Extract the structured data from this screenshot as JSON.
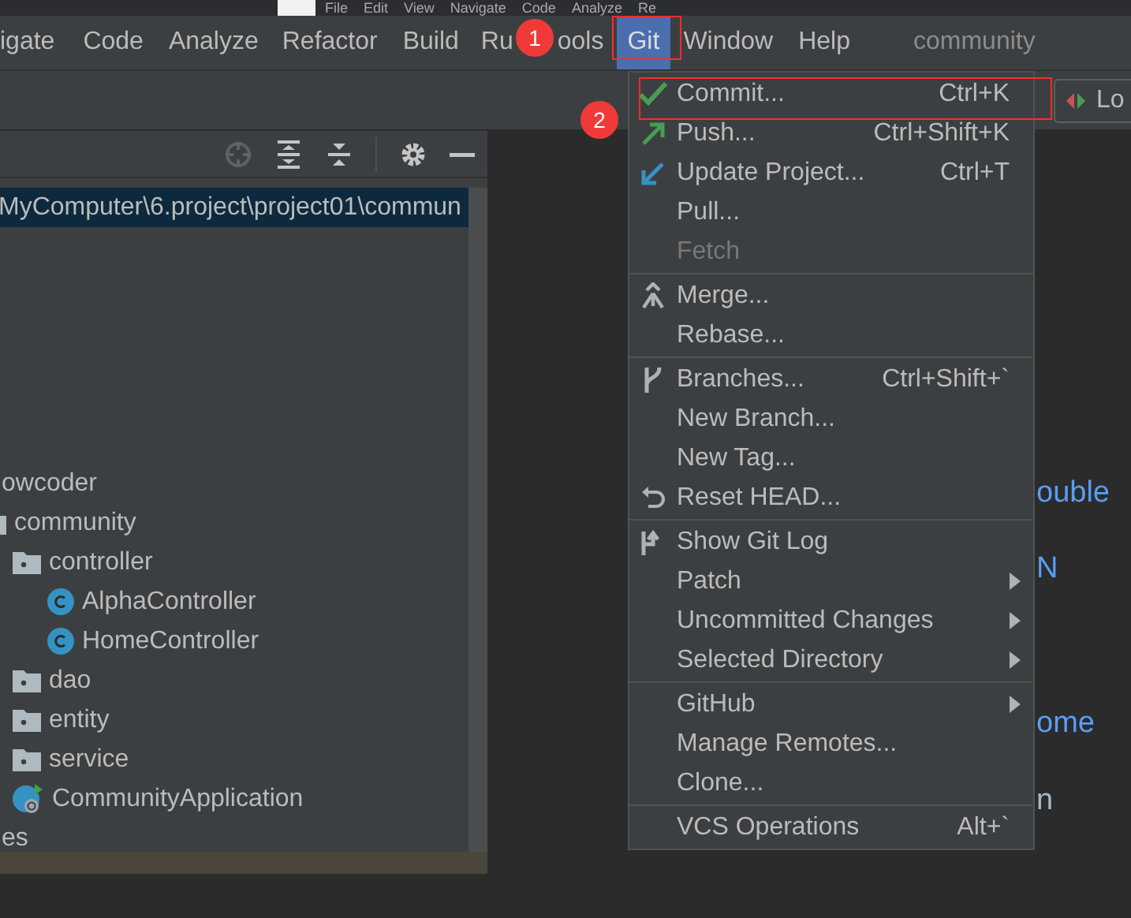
{
  "inner_menu": [
    "File",
    "Edit",
    "View",
    "Navigate",
    "Code",
    "Analyze",
    "Re"
  ],
  "menubar": {
    "items": [
      {
        "label": "igate",
        "selected": false
      },
      {
        "label": "Code",
        "selected": false
      },
      {
        "label": "Analyze",
        "selected": false
      },
      {
        "label": "Refactor",
        "selected": false
      },
      {
        "label": "Build",
        "selected": false
      },
      {
        "label": "Ru",
        "selected": false
      },
      {
        "label": "ools",
        "selected": false
      },
      {
        "label": "Git",
        "selected": true
      },
      {
        "label": "Window",
        "selected": false
      },
      {
        "label": "Help",
        "selected": false
      }
    ],
    "project": "community"
  },
  "toolbar": {
    "run_config": "Lo"
  },
  "project_panel": {
    "path": "MyComputer\\6.project\\project01\\commun",
    "tree": [
      {
        "label": "owcoder",
        "kind": "text"
      },
      {
        "label": "community",
        "kind": "folder",
        "children": [
          {
            "label": "controller",
            "kind": "folder",
            "children": [
              {
                "label": "AlphaController",
                "kind": "class"
              },
              {
                "label": "HomeController",
                "kind": "class"
              }
            ]
          },
          {
            "label": "dao",
            "kind": "folder"
          },
          {
            "label": "entity",
            "kind": "folder"
          },
          {
            "label": "service",
            "kind": "folder"
          },
          {
            "label": "CommunityApplication",
            "kind": "app"
          }
        ]
      },
      {
        "label": "es",
        "kind": "text"
      }
    ]
  },
  "editor_hints": [
    {
      "text": "ouble",
      "kind": "link"
    },
    {
      "text": "N",
      "kind": "link"
    },
    {
      "text": "ome",
      "kind": "link"
    },
    {
      "text": "n",
      "kind": "plain"
    }
  ],
  "git_menu": {
    "groups": [
      [
        {
          "label": "Commit...",
          "shortcut": "Ctrl+K",
          "disabled": false,
          "submenu": false
        },
        {
          "label": "Push...",
          "shortcut": "Ctrl+Shift+K",
          "disabled": false,
          "submenu": false
        },
        {
          "label": "Update Project...",
          "shortcut": "Ctrl+T",
          "disabled": false,
          "submenu": false
        },
        {
          "label": "Pull...",
          "disabled": false,
          "submenu": false
        },
        {
          "label": "Fetch",
          "disabled": true,
          "submenu": false
        }
      ],
      [
        {
          "label": "Merge...",
          "disabled": false,
          "submenu": false
        },
        {
          "label": "Rebase...",
          "disabled": false,
          "submenu": false
        }
      ],
      [
        {
          "label": "Branches...",
          "shortcut": "Ctrl+Shift+`",
          "disabled": false,
          "submenu": false
        },
        {
          "label": "New Branch...",
          "disabled": false,
          "submenu": false
        },
        {
          "label": "New Tag...",
          "disabled": false,
          "submenu": false
        },
        {
          "label": "Reset HEAD...",
          "disabled": false,
          "submenu": false
        }
      ],
      [
        {
          "label": "Show Git Log",
          "disabled": false,
          "submenu": false
        },
        {
          "label": "Patch",
          "disabled": false,
          "submenu": true
        },
        {
          "label": "Uncommitted Changes",
          "disabled": false,
          "submenu": true
        },
        {
          "label": "Selected Directory",
          "disabled": false,
          "submenu": true
        }
      ],
      [
        {
          "label": "GitHub",
          "disabled": false,
          "submenu": true
        },
        {
          "label": "Manage Remotes...",
          "disabled": false,
          "submenu": false
        },
        {
          "label": "Clone...",
          "disabled": false,
          "submenu": false
        }
      ],
      [
        {
          "label": "VCS Operations",
          "shortcut": "Alt+`",
          "disabled": false,
          "submenu": false
        }
      ]
    ]
  },
  "annotations": [
    {
      "number": "1"
    },
    {
      "number": "2"
    }
  ]
}
